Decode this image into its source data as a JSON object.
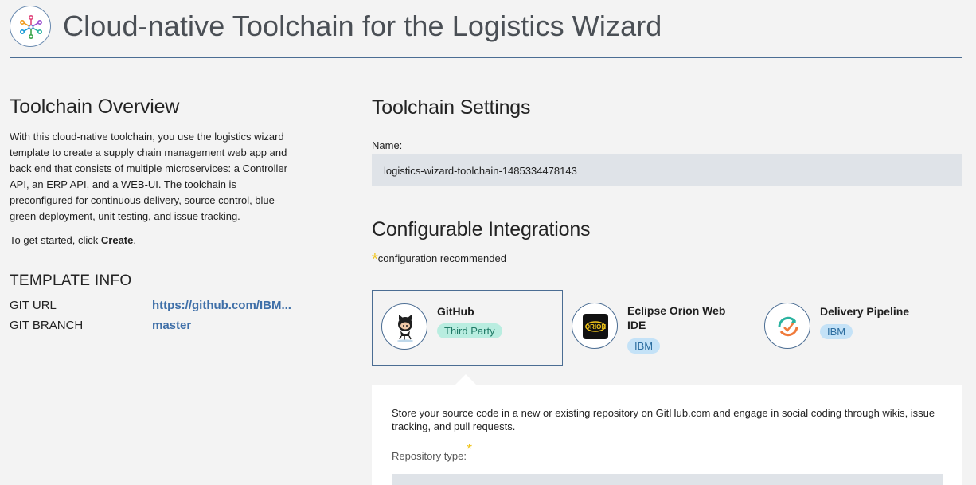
{
  "header": {
    "title": "Cloud-native Toolchain for the Logistics Wizard",
    "logo_icon": "toolchain-logo-icon"
  },
  "overview": {
    "title": "Toolchain Overview",
    "description": "With this cloud-native toolchain, you use the logistics wizard template to create a supply chain management web app and back end that consists of multiple microservices: a Controller API, an ERP API, and a WEB-UI. The toolchain is preconfigured for continuous delivery, source control, blue-green deployment, unit testing, and issue tracking.",
    "started_prefix": "To get started, click ",
    "started_bold": "Create",
    "started_suffix": "."
  },
  "template_info": {
    "title": "TEMPLATE INFO",
    "git_url_label": "GIT URL",
    "git_url_value": "https://github.com/IBM...",
    "git_branch_label": "GIT BRANCH",
    "git_branch_value": "master"
  },
  "settings": {
    "title": "Toolchain Settings",
    "name_label": "Name:",
    "name_value": "logistics-wizard-toolchain-1485334478143"
  },
  "integrations": {
    "title": "Configurable Integrations",
    "star": "*",
    "recommend_text": "configuration recommended",
    "cards": [
      {
        "name": "GitHub",
        "badge": "Third Party",
        "icon": "github-octocat-icon"
      },
      {
        "name": "Eclipse Orion Web IDE",
        "badge": "IBM",
        "icon": "orion-icon"
      },
      {
        "name": "Delivery Pipeline",
        "badge": "IBM",
        "icon": "delivery-pipeline-icon"
      }
    ]
  },
  "panel": {
    "description": "Store your source code in a new or existing repository on GitHub.com and engage in social coding through wikis, issue tracking, and pull requests.",
    "repo_type_label": "Repository type:",
    "star": "*"
  },
  "colors": {
    "accent": "#4b6d93",
    "link": "#3e6fa8",
    "third_party_badge": "#b9ede0",
    "ibm_badge": "#c4e2f7",
    "star": "#f0c419"
  }
}
